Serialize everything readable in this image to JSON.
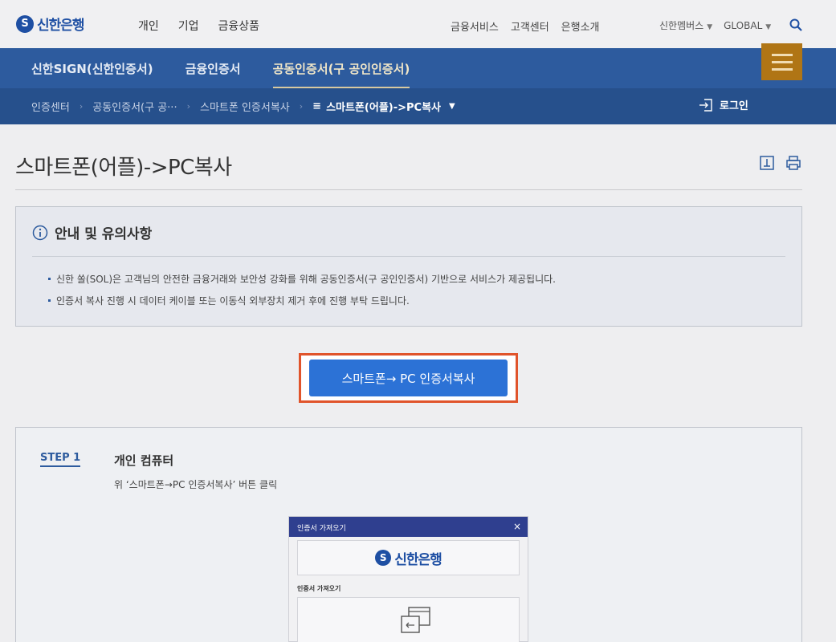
{
  "brand": {
    "name": "신한은행",
    "mark": "S"
  },
  "main_nav": [
    "개인",
    "기업",
    "금융상품"
  ],
  "util_nav": [
    "금융서비스",
    "고객센터",
    "은행소개"
  ],
  "member_nav": {
    "member": "신한멤버스",
    "global": "GLOBAL"
  },
  "blue_nav": {
    "tabs": [
      "신한SIGN(신한인증서)",
      "금융인증서",
      "공동인증서(구 공인인증서)"
    ]
  },
  "breadcrumb": {
    "items": [
      "인증센터",
      "공동인증서(구 공···",
      "스마트폰 인증서복사"
    ],
    "current": "스마트폰(어플)->PC복사"
  },
  "login_label": "로그인",
  "page_title": "스마트폰(어플)->PC복사",
  "notice": {
    "title": "안내 및 유의사항",
    "items": [
      "신한 쏠(SOL)은 고객님의 안전한 금융거래와 보안성 강화를 위해 공동인증서(구 공인인증서) 기반으로 서비스가 제공됩니다.",
      "인증서 복사 진행 시 데이터 케이블 또는 이동식 외부장치 제거 후에 진행 부탁 드립니다."
    ]
  },
  "primary_button": "스마트폰→ PC 인증서복사",
  "step": {
    "label": "STEP 1",
    "title": "개인 컴퓨터",
    "desc": "위 ‘스마트폰→PC 인증서복사’ 버튼 클릭"
  },
  "popup": {
    "title": "인증서 가져오기",
    "close": "×",
    "subtitle": "인증서 가져오기"
  },
  "colors": {
    "brand_blue": "#1e4fa3",
    "nav_blue": "#2d5b9e",
    "crumb_blue": "#26508c",
    "menu_gold": "#b07515",
    "button_blue": "#2c72d6",
    "highlight": "#e0542b"
  }
}
